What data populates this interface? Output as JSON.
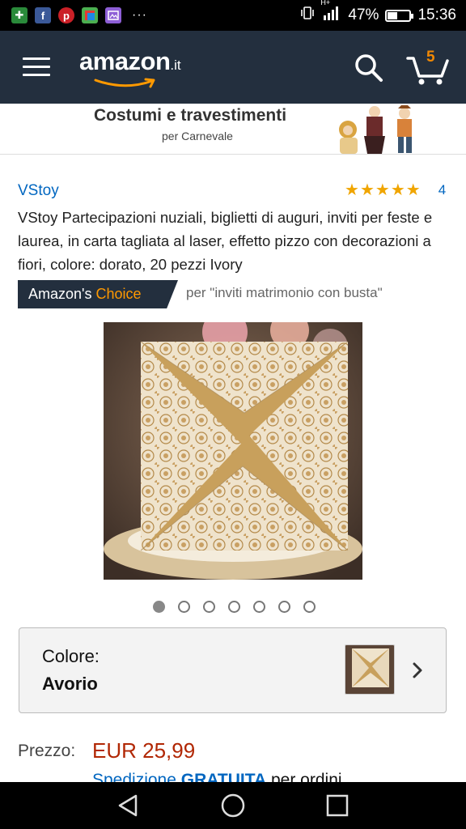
{
  "status_bar": {
    "dots": "···",
    "battery_percent": "47%",
    "battery_level": 0.47,
    "time": "15:36",
    "net_label": "H+"
  },
  "header": {
    "logo_text": "amazon",
    "logo_tld": ".it",
    "cart_count": "5",
    "brand_color": "#232f3e",
    "accent_color": "#ff9900"
  },
  "banner": {
    "title": "Costumi e travestimenti",
    "subtitle": "per Carnevale"
  },
  "product": {
    "brand": "VStoy",
    "rating_stars": 5,
    "rating_count": "4",
    "title": "VStoy Partecipazioni nuziali, biglietti di auguri, inviti per feste e laurea, in carta tagliata al laser, effetto pizzo con decorazioni a fiori, colore: dorato, 20 pezzi Ivory",
    "choice_badge_a": "Amazon's",
    "choice_badge_b": "Choice",
    "choice_for": "per \"inviti matrimonio con busta\"",
    "image_count": 7,
    "active_image": 1
  },
  "color_selector": {
    "label": "Colore:",
    "value": "Avorio"
  },
  "price": {
    "label": "Prezzo:",
    "value": "EUR 25,99",
    "shipping_a": "Spedizione",
    "shipping_b": "GRATUITA",
    "shipping_c": "per ordini"
  }
}
